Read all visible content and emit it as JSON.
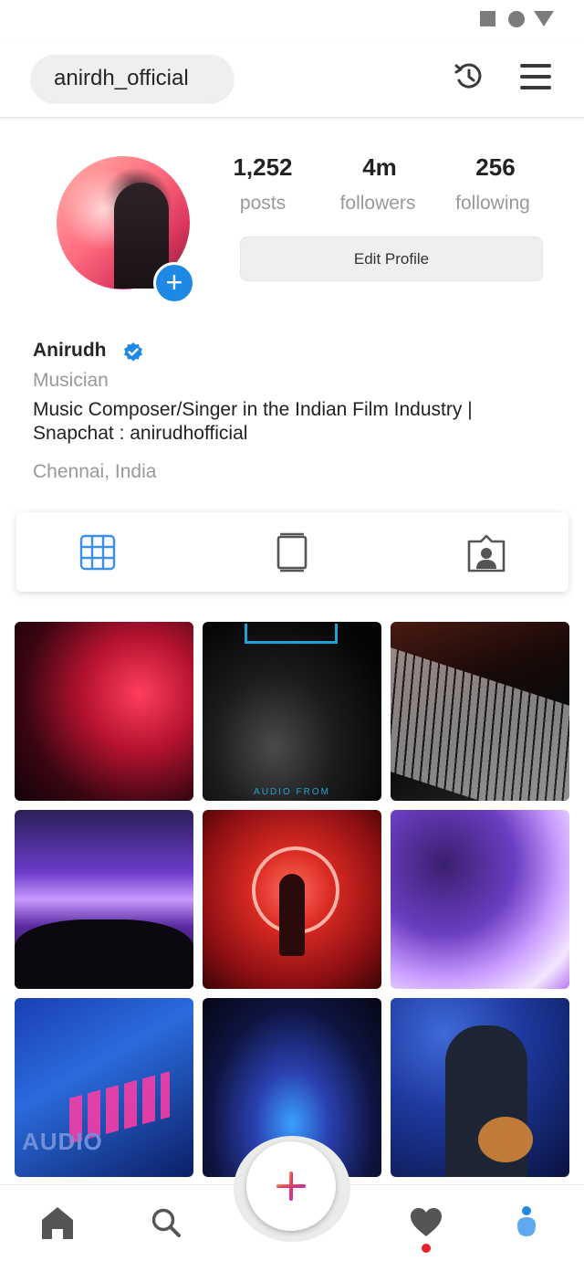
{
  "header": {
    "username": "anirdh_official"
  },
  "stats": [
    {
      "value": "1,252",
      "label": "posts"
    },
    {
      "value": "4m",
      "label": "followers"
    },
    {
      "value": "256",
      "label": "following"
    }
  ],
  "edit_profile_label": "Edit Profile",
  "profile": {
    "name": "Anirudh",
    "category": "Musician",
    "bio_line1": "Music Composer/Singer in the Indian Film Industry |",
    "bio_line2": "Snapchat : anirudhofficial",
    "location": "Chennai, India"
  },
  "posts": [
    {
      "name": "post-red-portrait",
      "caption": ""
    },
    {
      "name": "post-album-cover",
      "caption": "AUDIO FROM"
    },
    {
      "name": "post-keyboard-hands",
      "caption": ""
    },
    {
      "name": "post-concert-crowd",
      "caption": ""
    },
    {
      "name": "post-neon-art",
      "caption": ""
    },
    {
      "name": "post-purple-portrait",
      "caption": ""
    },
    {
      "name": "post-launchpad",
      "caption": "AUDIO"
    },
    {
      "name": "post-stage-lights",
      "caption": ""
    },
    {
      "name": "post-guitarist",
      "caption": ""
    }
  ],
  "colors": {
    "accent": "#1e88e5",
    "notification": "#e8202a",
    "muted": "#999999"
  },
  "icons": [
    "history-icon",
    "menu-icon",
    "grid-icon",
    "igtv-icon",
    "tagged-icon",
    "home-icon",
    "search-icon",
    "add-icon",
    "heart-icon",
    "profile-icon"
  ]
}
